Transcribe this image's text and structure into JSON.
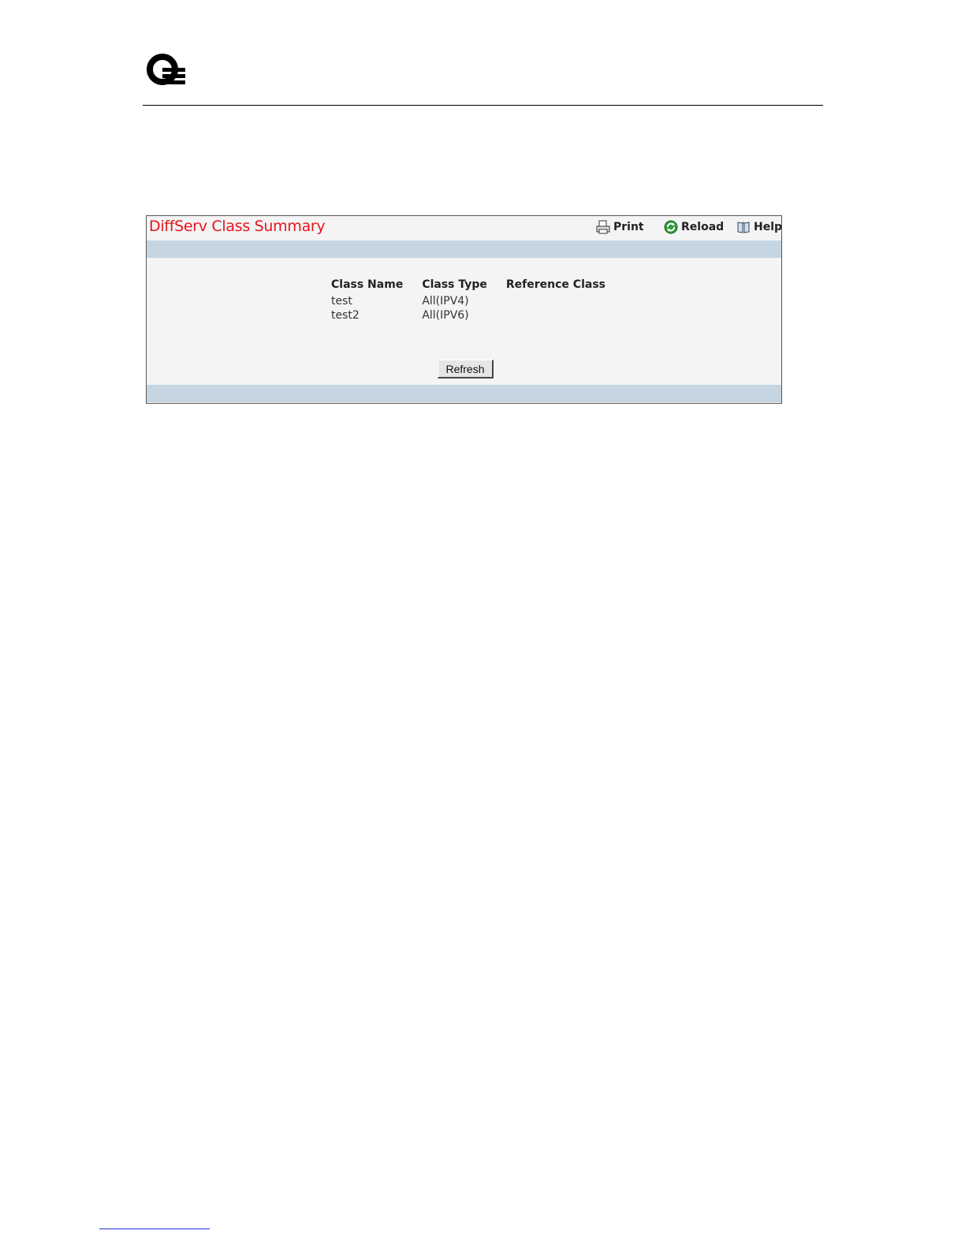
{
  "panel": {
    "title": "DiffServ Class Summary",
    "toolbar": {
      "print_label": "Print",
      "reload_label": "Reload",
      "help_label": "Help"
    }
  },
  "table": {
    "headers": [
      "Class Name",
      "Class Type",
      "Reference Class"
    ],
    "rows": [
      [
        "test",
        "All(IPV4)",
        ""
      ],
      [
        "test2",
        "All(IPV6)",
        ""
      ]
    ]
  },
  "buttons": {
    "refresh_label": "Refresh"
  },
  "icons": {
    "logo": "company-logo",
    "print": "printer-icon",
    "reload": "reload-icon",
    "help": "help-book-icon"
  },
  "colors": {
    "title": "#e8141b",
    "band": "#c5d6e2",
    "panel_bg": "#f4f4f4",
    "reload_icon": "#2e9a3a"
  }
}
